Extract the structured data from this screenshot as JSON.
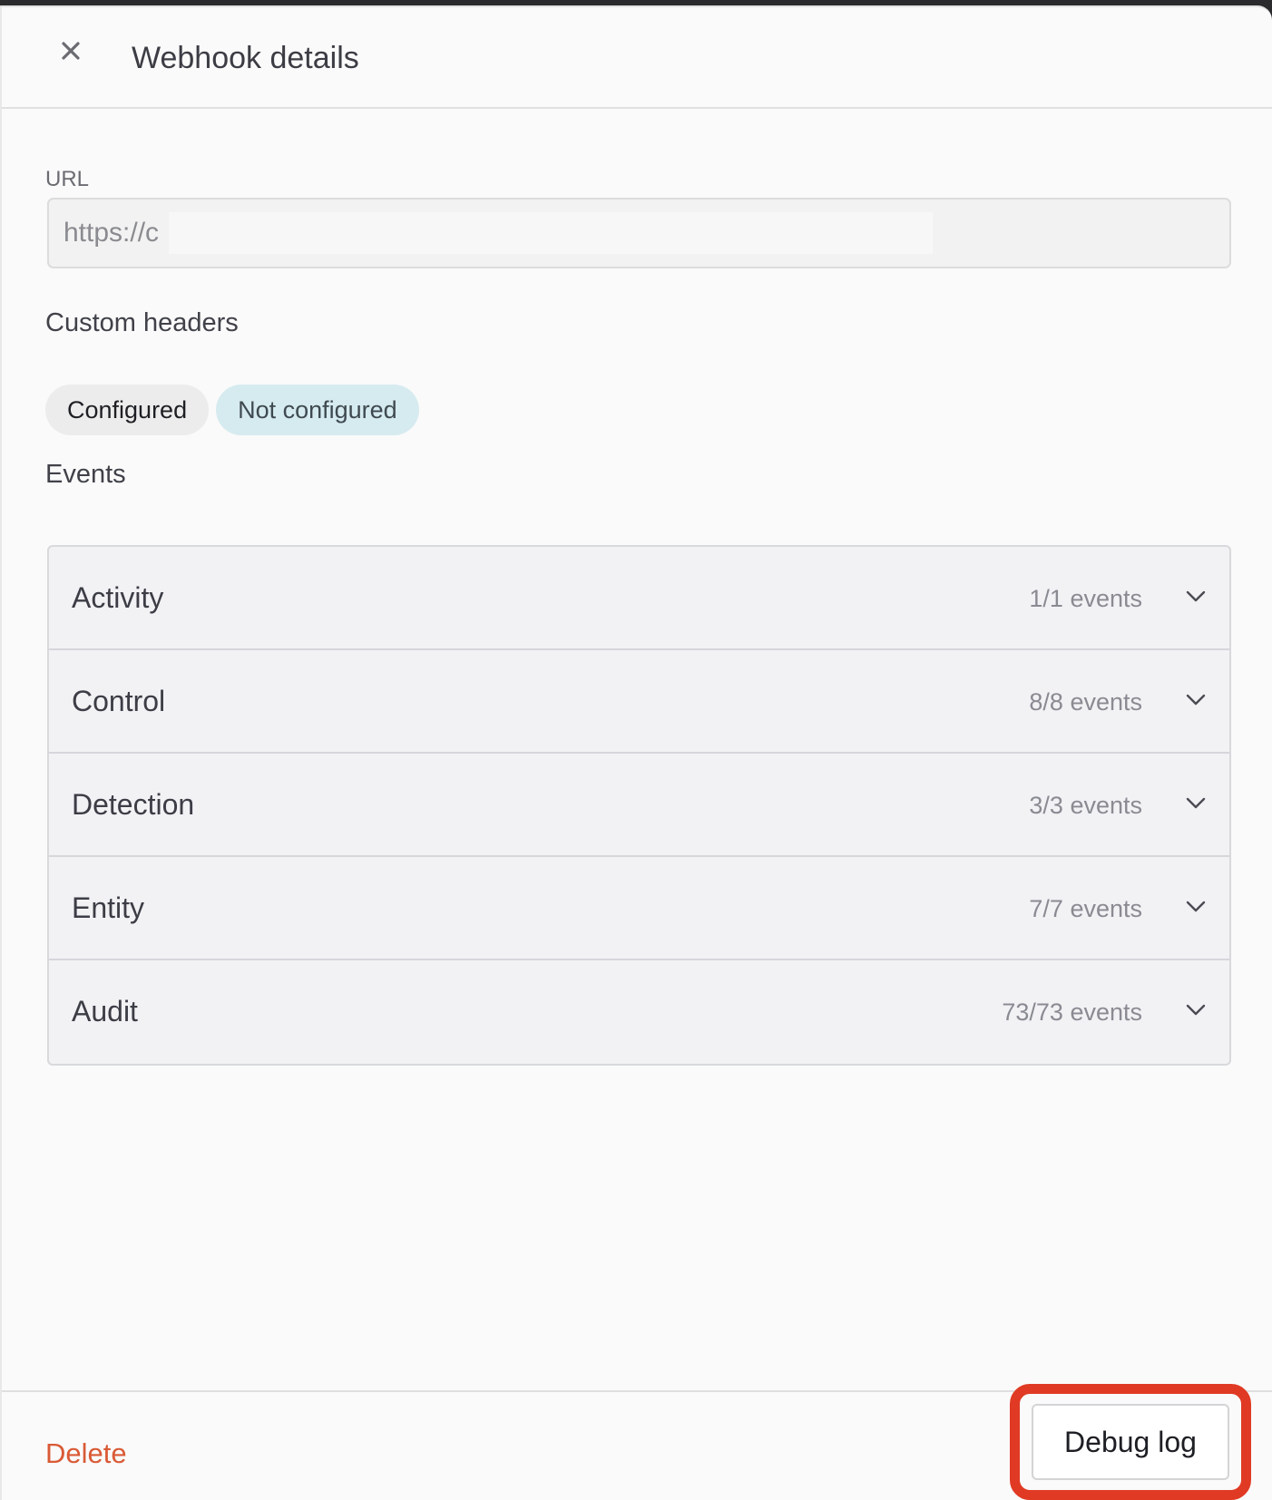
{
  "header": {
    "title": "Webhook details",
    "close_icon": "close-icon"
  },
  "url": {
    "label": "URL",
    "value": "https://c"
  },
  "custom_headers": {
    "label": "Custom headers",
    "options": [
      "Configured",
      "Not configured"
    ],
    "selected": "Not configured"
  },
  "events": {
    "label": "Events",
    "items": [
      {
        "name": "Activity",
        "count": "1/1 events"
      },
      {
        "name": "Control",
        "count": "8/8 events"
      },
      {
        "name": "Detection",
        "count": "3/3 events"
      },
      {
        "name": "Entity",
        "count": "7/7 events"
      },
      {
        "name": "Audit",
        "count": "73/73 events"
      }
    ]
  },
  "footer": {
    "delete_label": "Delete",
    "debug_label": "Debug log"
  },
  "colors": {
    "delete": "#d95a36",
    "selected_pill": "#d6ebef",
    "highlight": "#e03a24"
  }
}
